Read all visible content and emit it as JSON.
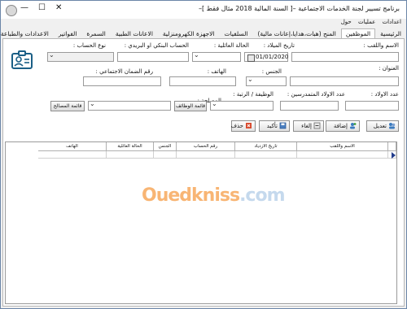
{
  "window": {
    "title": "برنامج تسيير لجنة الخدمات الاجتماعية –[ السنة المالية 2018 مثال فقط ]–",
    "buttons": [
      "—",
      "☐",
      "✕"
    ]
  },
  "menu": [
    "اعدادات",
    "عمليات",
    "حول"
  ],
  "tabs": [
    {
      "label": "الرئيسية",
      "active": false
    },
    {
      "label": "الموظفين",
      "active": true
    },
    {
      "label": "المنح (هبات،هدايا،إعانات مالية)",
      "active": false
    },
    {
      "label": "السلفيات",
      "active": false
    },
    {
      "label": "الاجهزة الكهرومنزلية",
      "active": false
    },
    {
      "label": "الاعانات الطبية",
      "active": false
    },
    {
      "label": "السمرة",
      "active": false
    },
    {
      "label": "الفواتير",
      "active": false
    },
    {
      "label": "الاعدادات والطباعة",
      "active": false
    }
  ],
  "form": {
    "name_label": "الاسم واللقب :",
    "birth_label": "تاريخ الميلاد :",
    "birth_value": "01/01/2020",
    "marital_label": "الحالة العائلية :",
    "bank_label": "الحساب البنكي او البريدي :",
    "account_type_label": "نوع الحساب :",
    "address_label": "العنوان :",
    "gender_label": "الجنس :",
    "phone_label": "الهاتف :",
    "ssn_label": "رقم الضمان الاجتماعي :",
    "children_label": "عدد الاولاد :",
    "school_children_label": "عدد الاولاد المتمدرسين :",
    "job_label": "الوظيفة / الرتبة :",
    "dept_label": "المصلحة :",
    "jobs_list_btn": "قائمة الوظائف",
    "dept_list_btn": "قائمة المصالح"
  },
  "actions": {
    "edit": "تعديل",
    "add": "إضافة",
    "cancel": "إلغاء",
    "confirm": "تأكيد",
    "delete": "حذف"
  },
  "table": {
    "columns": [
      "الاسم واللقب",
      "تاريخ الازدياد",
      "رقم الحساب",
      "الجنس",
      "الحالة العائلية",
      "الهاتف"
    ]
  },
  "watermark": {
    "main": "Ouedkniss",
    "suffix": ".com"
  }
}
